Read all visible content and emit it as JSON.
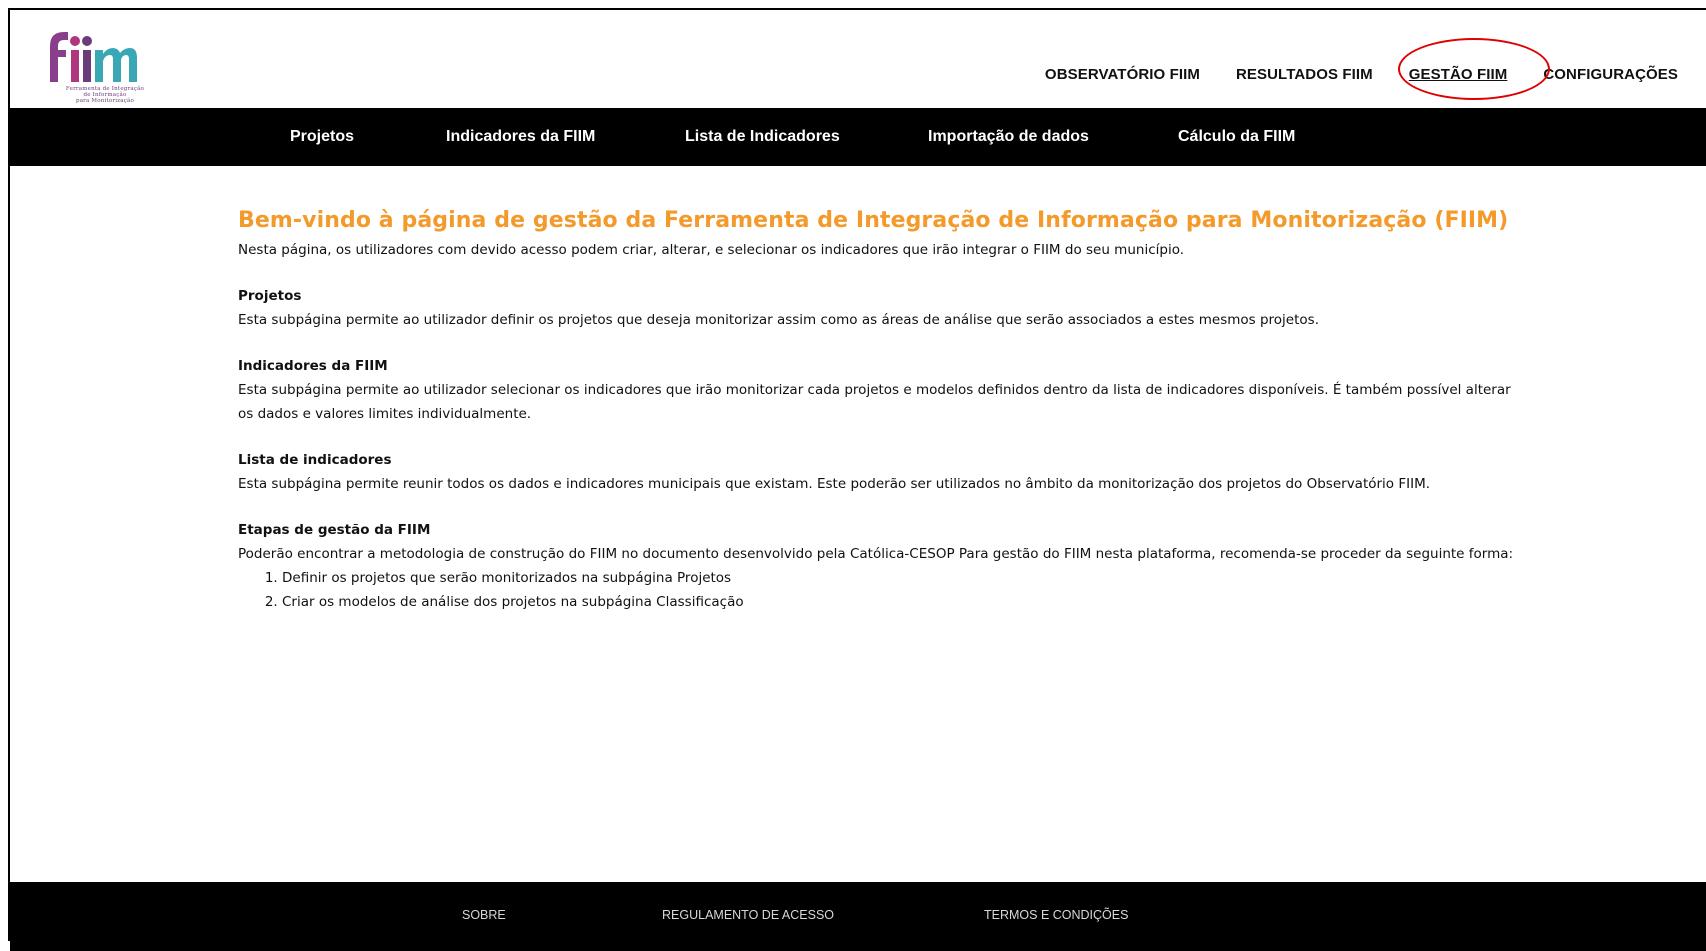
{
  "logo": {
    "wordmark": "fiim",
    "tagline": [
      "Ferramenta de Integração",
      "de Informação",
      "para Monitorização"
    ]
  },
  "topnav": {
    "items": [
      "OBSERVATÓRIO FIIM",
      "RESULTADOS FIIM",
      "GESTÃO FIIM",
      "CONFIGURAÇÕES"
    ],
    "active": "GESTÃO FIIM"
  },
  "subnav": {
    "items": [
      "Projetos",
      "Indicadores da FIIM",
      "Lista de Indicadores",
      "Importação de dados",
      "Cálculo da FIIM"
    ]
  },
  "main": {
    "title": "Bem-vindo à página de gestão da Ferramenta de Integração de Informação para Monitorização (FIIM)",
    "intro": "Nesta página, os utilizadores com devido acesso podem criar, alterar, e selecionar os indicadores que irão integrar o FIIM do seu município.",
    "sections": [
      {
        "heading": "Projetos",
        "text": "Esta subpágina permite ao utilizador definir os projetos que deseja monitorizar assim como as áreas de análise que serão associados a estes mesmos projetos."
      },
      {
        "heading": "Indicadores da FIIM",
        "text": "Esta subpágina permite ao utilizador selecionar os indicadores que irão monitorizar cada projetos e modelos definidos dentro da lista de indicadores disponíveis. É também possível alterar os dados e valores limites individualmente."
      },
      {
        "heading": "Lista de indicadores",
        "text": "Esta subpágina permite reunir todos os dados e indicadores municipais que existam. Este poderão ser utilizados no âmbito da monitorização dos projetos do Observatório FIIM."
      },
      {
        "heading": "Etapas de gestão da FIIM",
        "text": "Poderão encontrar a metodologia de construção do FIIM no documento desenvolvido pela Católica-CESOP Para gestão do FIIM nesta plataforma, recomenda-se proceder da seguinte forma:",
        "steps": [
          "Definir os projetos que serão monitorizados na subpágina Projetos",
          "Criar os modelos de análise dos projetos na subpágina Classificação"
        ]
      }
    ]
  },
  "footer": {
    "items": [
      "SOBRE",
      "REGULAMENTO DE ACESSO",
      "TERMOS E CONDIÇÕES"
    ]
  },
  "colors": {
    "title_orange": "#f39a2b",
    "logo_purple": "#6a3d7a",
    "logo_teal": "#3aa7b5",
    "logo_magenta": "#b0357e",
    "annotation_red": "#e00000"
  }
}
